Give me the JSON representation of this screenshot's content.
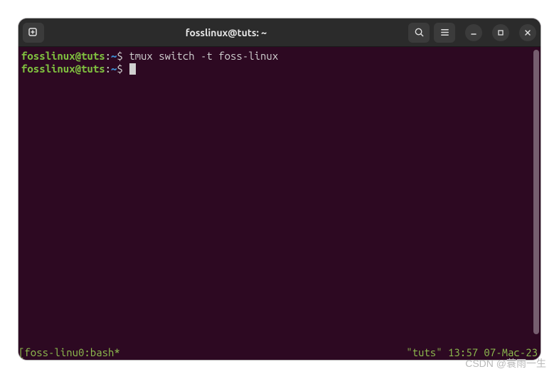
{
  "window": {
    "title": "fosslinux@tuts: ~"
  },
  "prompt": {
    "user_host": "fosslinux@tuts",
    "path": "~",
    "symbol": "$"
  },
  "lines": {
    "cmd1": "tmux switch -t foss-linux",
    "cmd2": ""
  },
  "status": {
    "left": "[foss-linu0:bash*",
    "right": "\"tuts\" 13:57 07-Mac-23"
  },
  "watermark": "CSDN @蓑雨一生"
}
